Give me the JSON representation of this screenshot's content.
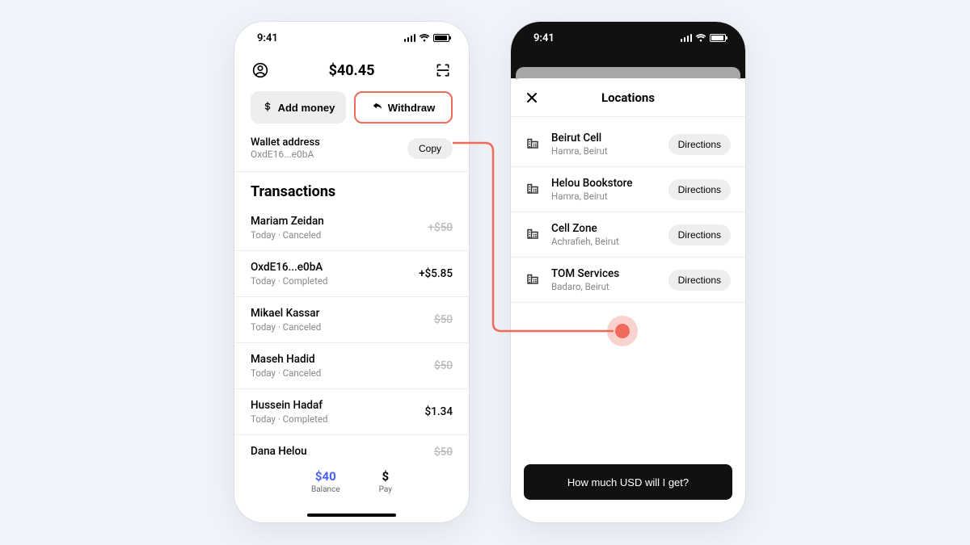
{
  "status": {
    "time": "9:41"
  },
  "left": {
    "balance": "$40.45",
    "add_money_label": "Add money",
    "withdraw_label": "Withdraw",
    "wallet_title": "Wallet address",
    "wallet_value": "OxdE16...e0bA",
    "copy_label": "Copy",
    "tx_header": "Transactions",
    "transactions": [
      {
        "name": "Mariam Zeidan",
        "meta": "Today · Canceled",
        "amount": "+$50",
        "canceled": true
      },
      {
        "name": "OxdE16...e0bA",
        "meta": "Today · Completed",
        "amount": "+$5.85",
        "canceled": false
      },
      {
        "name": "Mikael Kassar",
        "meta": "Today · Canceled",
        "amount": "$50",
        "canceled": true
      },
      {
        "name": "Maseh Hadid",
        "meta": "Today · Canceled",
        "amount": "$50",
        "canceled": true
      },
      {
        "name": "Hussein Hadaf",
        "meta": "Today · Completed",
        "amount": "$1.34",
        "canceled": false
      },
      {
        "name": "Dana Helou",
        "meta": "",
        "amount": "$50",
        "canceled": true
      }
    ],
    "nav": {
      "balance_value": "$40",
      "balance_label": "Balance",
      "pay_symbol": "$",
      "pay_label": "Pay"
    }
  },
  "right": {
    "title": "Locations",
    "locations": [
      {
        "name": "Beirut Cell",
        "sub": "Hamra, Beirut",
        "btn": "Directions"
      },
      {
        "name": "Helou Bookstore",
        "sub": "Hamra, Beirut",
        "btn": "Directions"
      },
      {
        "name": "Cell Zone",
        "sub": "Achrafieh, Beirut",
        "btn": "Directions"
      },
      {
        "name": "TOM Services",
        "sub": "Badaro, Beirut",
        "btn": "Directions"
      }
    ],
    "cta": "How much USD will I get?"
  },
  "colors": {
    "accent": "#ef6a5a",
    "link": "#4a5fff"
  }
}
